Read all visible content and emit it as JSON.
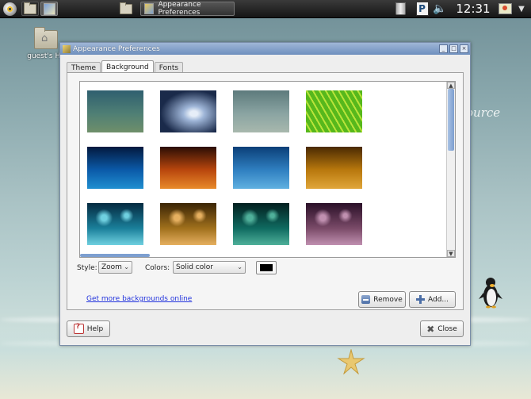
{
  "taskbar": {
    "task_title": "Appearance Preferences",
    "clock": "12:31",
    "tray_p_label": "P",
    "volume_glyph": "🔈",
    "dropdown_glyph": "▼"
  },
  "desktop": {
    "icon_label": "guest's Ho",
    "watermark_text": "ource"
  },
  "window": {
    "title": "Appearance Preferences",
    "tabs": [
      "Theme",
      "Background",
      "Fonts"
    ],
    "active_tab": "Background",
    "style_label": "Style:",
    "style_value": "Zoom",
    "colors_label": "Colors:",
    "colors_value": "Solid color",
    "color_swatch": "#000000",
    "link_text": "Get more backgrounds online",
    "remove_label": "Remove",
    "add_label": "Add...",
    "help_label": "Help",
    "close_label": "Close",
    "combo_arrow": "⌄",
    "scroll_up": "▲",
    "scroll_down": "▼"
  },
  "wallpapers": [
    {
      "name": "teal-gradient",
      "colors": [
        "#2f5f6f",
        "#4f7f75",
        "#6f8f6a"
      ]
    },
    {
      "name": "water-drop",
      "colors": [
        "#1a2a4a",
        "#9fb6d8",
        "#e6eef8"
      ]
    },
    {
      "name": "grey-sky",
      "colors": [
        "#5d7a7c",
        "#8aa4a2",
        "#a8b8ad"
      ]
    },
    {
      "name": "green-leaf",
      "colors": [
        "#0f5a0c",
        "#57b81c",
        "#b8e33a"
      ]
    },
    {
      "name": "blue-dusk",
      "colors": [
        "#03193e",
        "#0b5aa8",
        "#1f8fd0"
      ]
    },
    {
      "name": "orange-sunset",
      "colors": [
        "#2a0d05",
        "#b8460d",
        "#e88a2a"
      ]
    },
    {
      "name": "blue-horizon",
      "colors": [
        "#0b3f78",
        "#2f7fc0",
        "#5fb0e0"
      ]
    },
    {
      "name": "amber-horizon",
      "colors": [
        "#4a2a02",
        "#b8780d",
        "#e0a63a"
      ]
    },
    {
      "name": "aqua-bokeh",
      "colors": [
        "#052a40",
        "#1a7f9a",
        "#6fd0e0"
      ]
    },
    {
      "name": "golden-bokeh",
      "colors": [
        "#3a2405",
        "#a0701c",
        "#e6b060"
      ]
    },
    {
      "name": "teal-bokeh",
      "colors": [
        "#031f1f",
        "#0f6a60",
        "#4fb09a"
      ]
    },
    {
      "name": "purple-bokeh",
      "colors": [
        "#2a1028",
        "#7a4a68",
        "#c090b0"
      ]
    }
  ]
}
